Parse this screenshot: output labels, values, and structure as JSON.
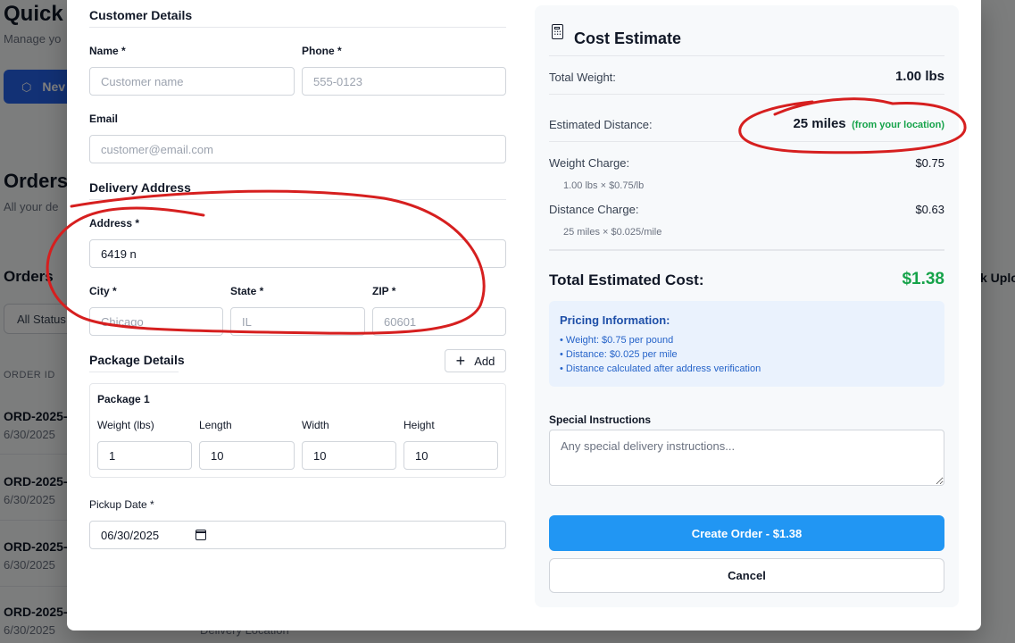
{
  "background": {
    "title": "Quick A",
    "subtitle": "Manage yo",
    "new_button": "Nev",
    "orders_title": "Orders",
    "orders_subtitle": "All your de",
    "orders_heading": "Orders",
    "status_filter": "All Status",
    "column_order_id": "ORDER ID",
    "rows": [
      {
        "id": "ORD-2025-",
        "date": "6/30/2025"
      },
      {
        "id": "ORD-2025-",
        "date": "6/30/2025"
      },
      {
        "id": "ORD-2025-",
        "date": "6/30/2025"
      },
      {
        "id": "ORD-2025-",
        "date": "6/30/2025"
      }
    ],
    "upload_label": "k Uplo",
    "delivery_location": "Delivery Location"
  },
  "form": {
    "customer_section": "Customer Details",
    "name_label": "Name *",
    "name_placeholder": "Customer name",
    "phone_label": "Phone *",
    "phone_placeholder": "555-0123",
    "email_label": "Email",
    "email_placeholder": "customer@email.com",
    "address_section": "Delivery Address",
    "address_label": "Address *",
    "address_value": "6419 n",
    "city_label": "City *",
    "city_placeholder": "Chicago",
    "state_label": "State *",
    "state_placeholder": "IL",
    "zip_label": "ZIP *",
    "zip_placeholder": "60601",
    "package_section": "Package Details",
    "add_button": "Add",
    "package_name": "Package 1",
    "weight_label": "Weight (lbs)",
    "weight_value": "1",
    "length_label": "Length",
    "length_value": "10",
    "width_label": "Width",
    "width_value": "10",
    "height_label": "Height",
    "height_value": "10",
    "pickup_label": "Pickup Date *",
    "pickup_value": "06/30/2025"
  },
  "estimate": {
    "title": "Cost Estimate",
    "total_weight_label": "Total Weight:",
    "total_weight_value": "1.00 lbs",
    "distance_label": "Estimated Distance:",
    "distance_value": "25 miles",
    "distance_note": "(from your location)",
    "weight_charge_label": "Weight Charge:",
    "weight_charge_value": "$0.75",
    "weight_charge_detail": "1.00 lbs × $0.75/lb",
    "distance_charge_label": "Distance Charge:",
    "distance_charge_value": "$0.63",
    "distance_charge_detail": "25 miles × $0.025/mile",
    "total_label": "Total Estimated Cost:",
    "total_value": "$1.38",
    "pricing_title": "Pricing Information:",
    "pricing_items": [
      "• Weight: $0.75 per pound",
      "• Distance: $0.025 per mile",
      "• Distance calculated after address verification"
    ],
    "instructions_label": "Special Instructions",
    "instructions_placeholder": "Any special delivery instructions...",
    "create_button": "Create Order - $1.38",
    "cancel_button": "Cancel"
  },
  "colors": {
    "primary": "#2196f3",
    "total_green": "#16a34a",
    "annotation_red": "#d61f1f",
    "info_bg": "#eaf2fd"
  }
}
